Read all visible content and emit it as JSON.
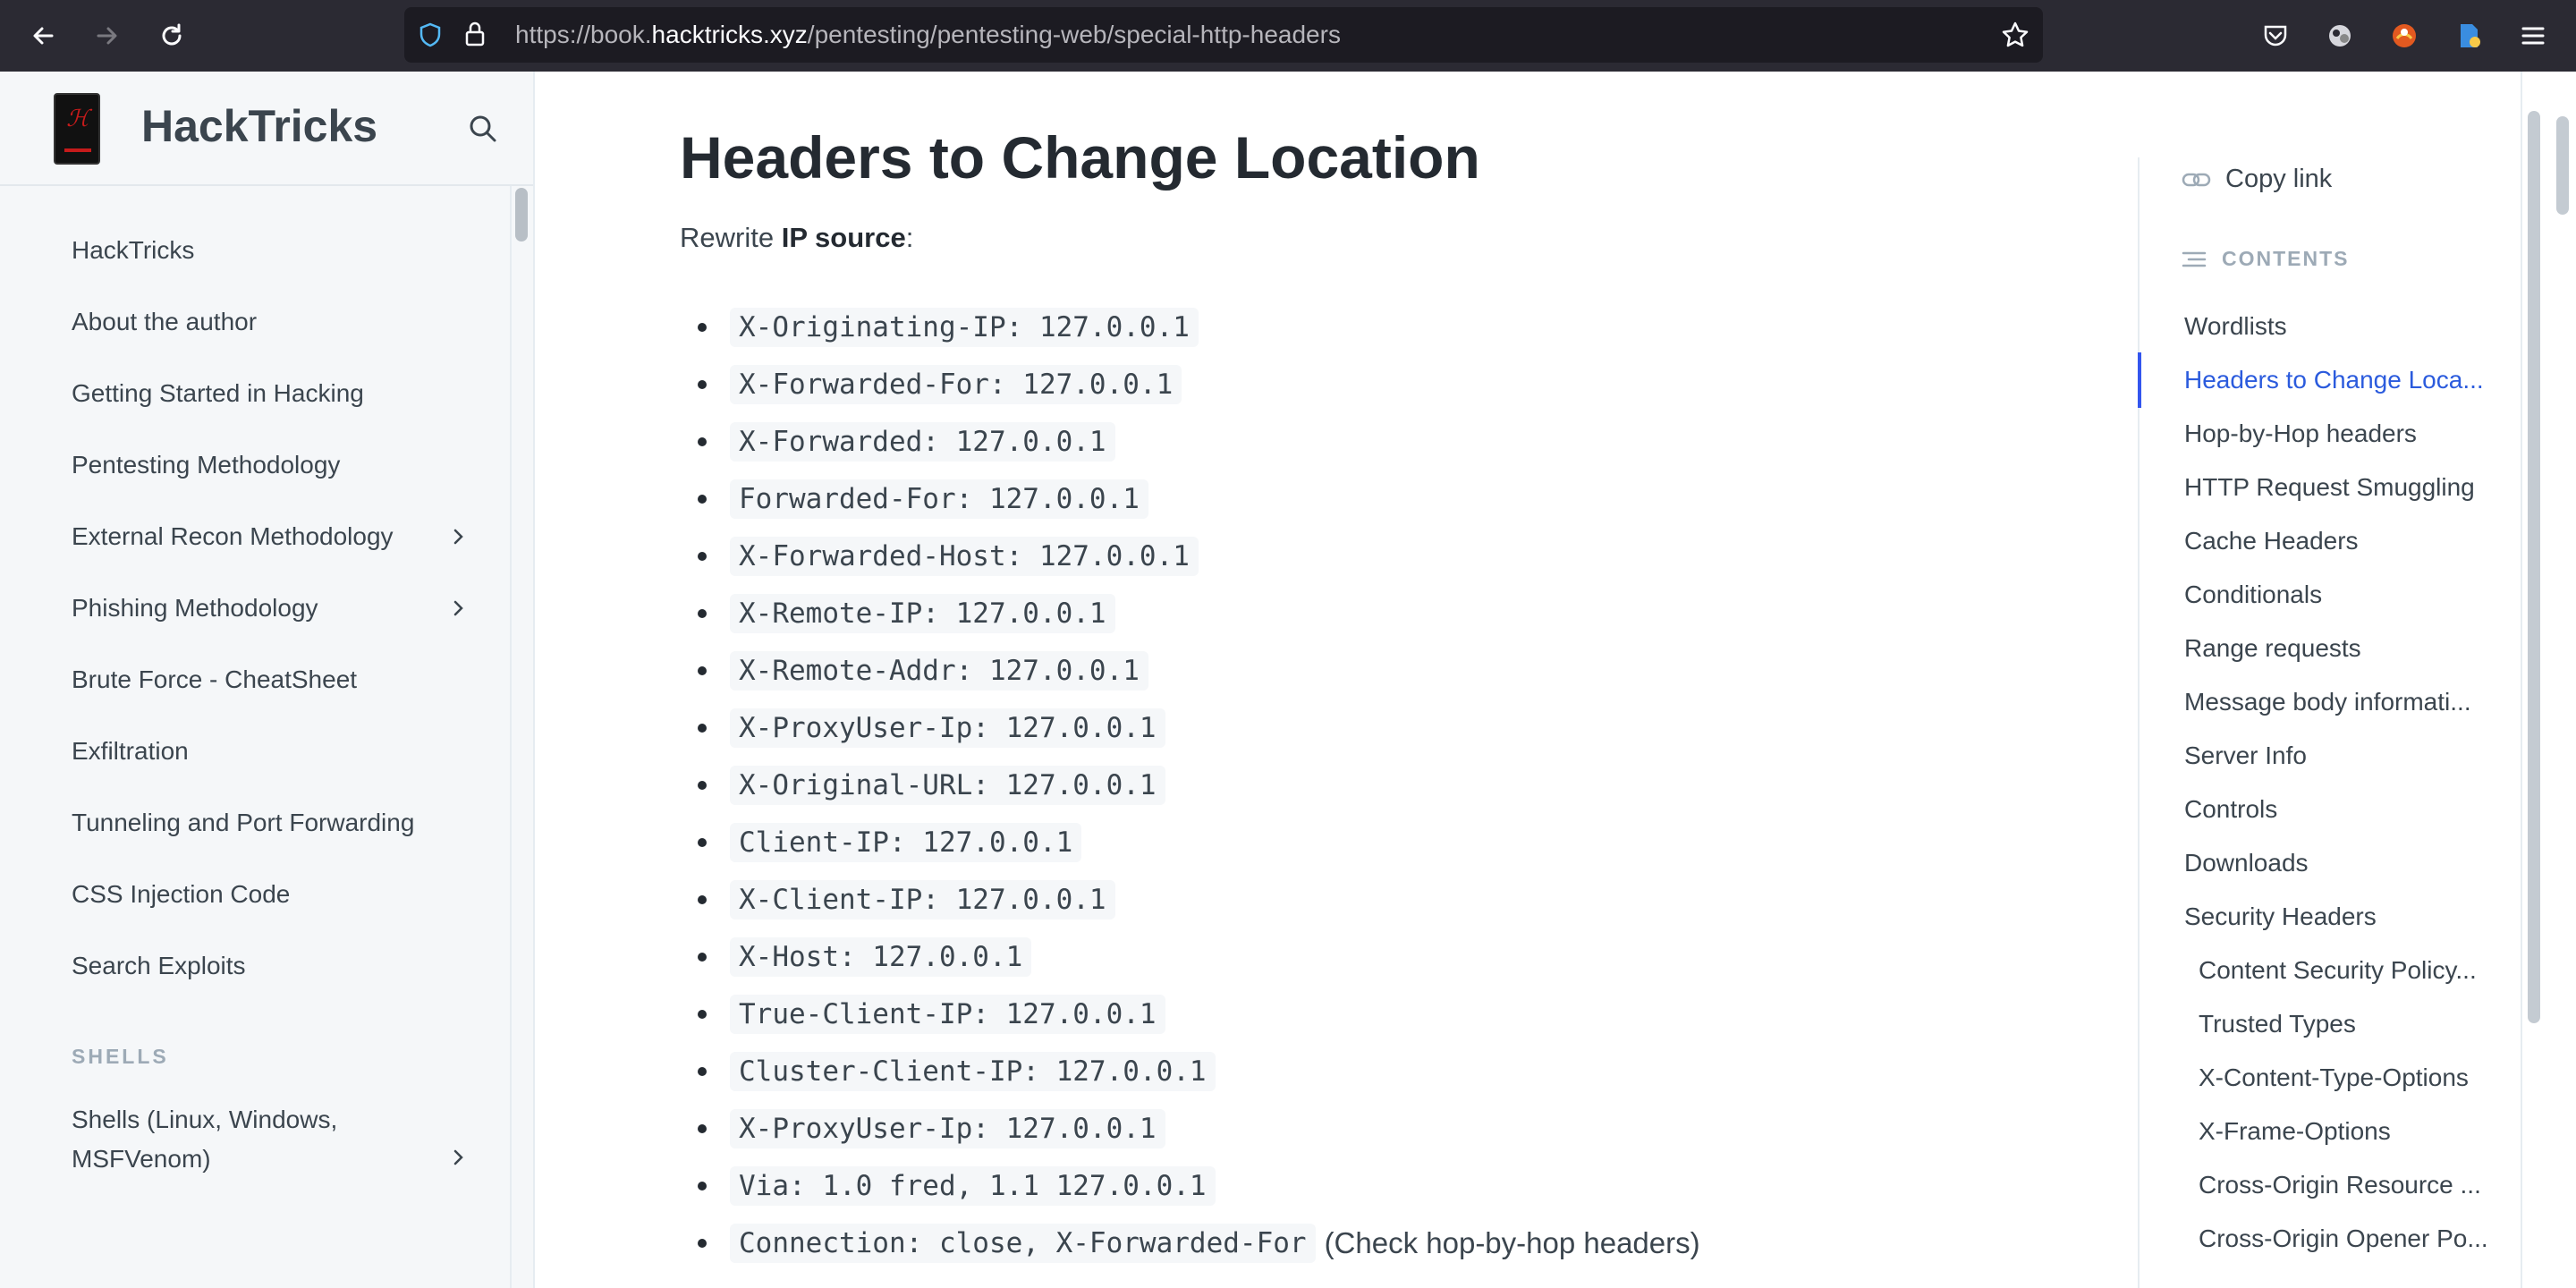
{
  "browser": {
    "url_prefix": "https://book.",
    "url_domain": "hacktricks.xyz",
    "url_path": "/pentesting/pentesting-web/special-http-headers"
  },
  "sidebar": {
    "title": "HackTricks",
    "items": [
      {
        "label": "HackTricks"
      },
      {
        "label": "About the author"
      },
      {
        "label": "Getting Started in Hacking"
      },
      {
        "label": "Pentesting Methodology"
      },
      {
        "label": "External Recon Methodology"
      },
      {
        "label": "Phishing Methodology"
      },
      {
        "label": "Brute Force - CheatSheet"
      },
      {
        "label": "Exfiltration"
      },
      {
        "label": "Tunneling and Port Forwarding"
      },
      {
        "label": "CSS Injection Code"
      },
      {
        "label": "Search Exploits"
      }
    ],
    "section_title": "SHELLS",
    "shells_line1": "Shells (Linux, Windows,",
    "shells_line2": "MSFVenom)"
  },
  "main": {
    "heading": "Headers to Change Location",
    "intro_prefix": "Rewrite ",
    "intro_bold": "IP source",
    "intro_suffix": ":",
    "headers": [
      "X-Originating-IP: 127.0.0.1",
      "X-Forwarded-For: 127.0.0.1",
      "X-Forwarded: 127.0.0.1",
      "Forwarded-For: 127.0.0.1",
      "X-Forwarded-Host: 127.0.0.1",
      "X-Remote-IP: 127.0.0.1",
      "X-Remote-Addr: 127.0.0.1",
      "X-ProxyUser-Ip: 127.0.0.1",
      "X-Original-URL: 127.0.0.1",
      "Client-IP: 127.0.0.1",
      "X-Client-IP: 127.0.0.1",
      "X-Host: 127.0.0.1",
      "True-Client-IP: 127.0.0.1",
      "Cluster-Client-IP: 127.0.0.1",
      "X-ProxyUser-Ip: 127.0.0.1",
      "Via: 1.0 fred, 1.1 127.0.0.1"
    ],
    "last_code": "Connection: close, X-Forwarded-For",
    "last_text": "(Check hop-by-hop headers)"
  },
  "toc": {
    "copy_link": "Copy link",
    "contents_label": "CONTENTS",
    "items": [
      "Wordlists",
      "Headers to Change Loca...",
      "Hop-by-Hop headers",
      "HTTP Request Smuggling",
      "Cache Headers",
      "Conditionals",
      "Range requests",
      "Message body informati...",
      "Server Info",
      "Controls",
      "Downloads",
      "Security Headers"
    ],
    "sub_items": [
      "Content Security Policy...",
      "Trusted Types",
      "X-Content-Type-Options",
      "X-Frame-Options",
      "Cross-Origin Resource ...",
      "Cross-Origin Opener Po..."
    ]
  },
  "colors": {
    "toolbar": "#2b2a33",
    "urlbar": "#1c1b22",
    "sidebar_bg": "#f5f7f9",
    "active_link": "#2b5bdd"
  }
}
